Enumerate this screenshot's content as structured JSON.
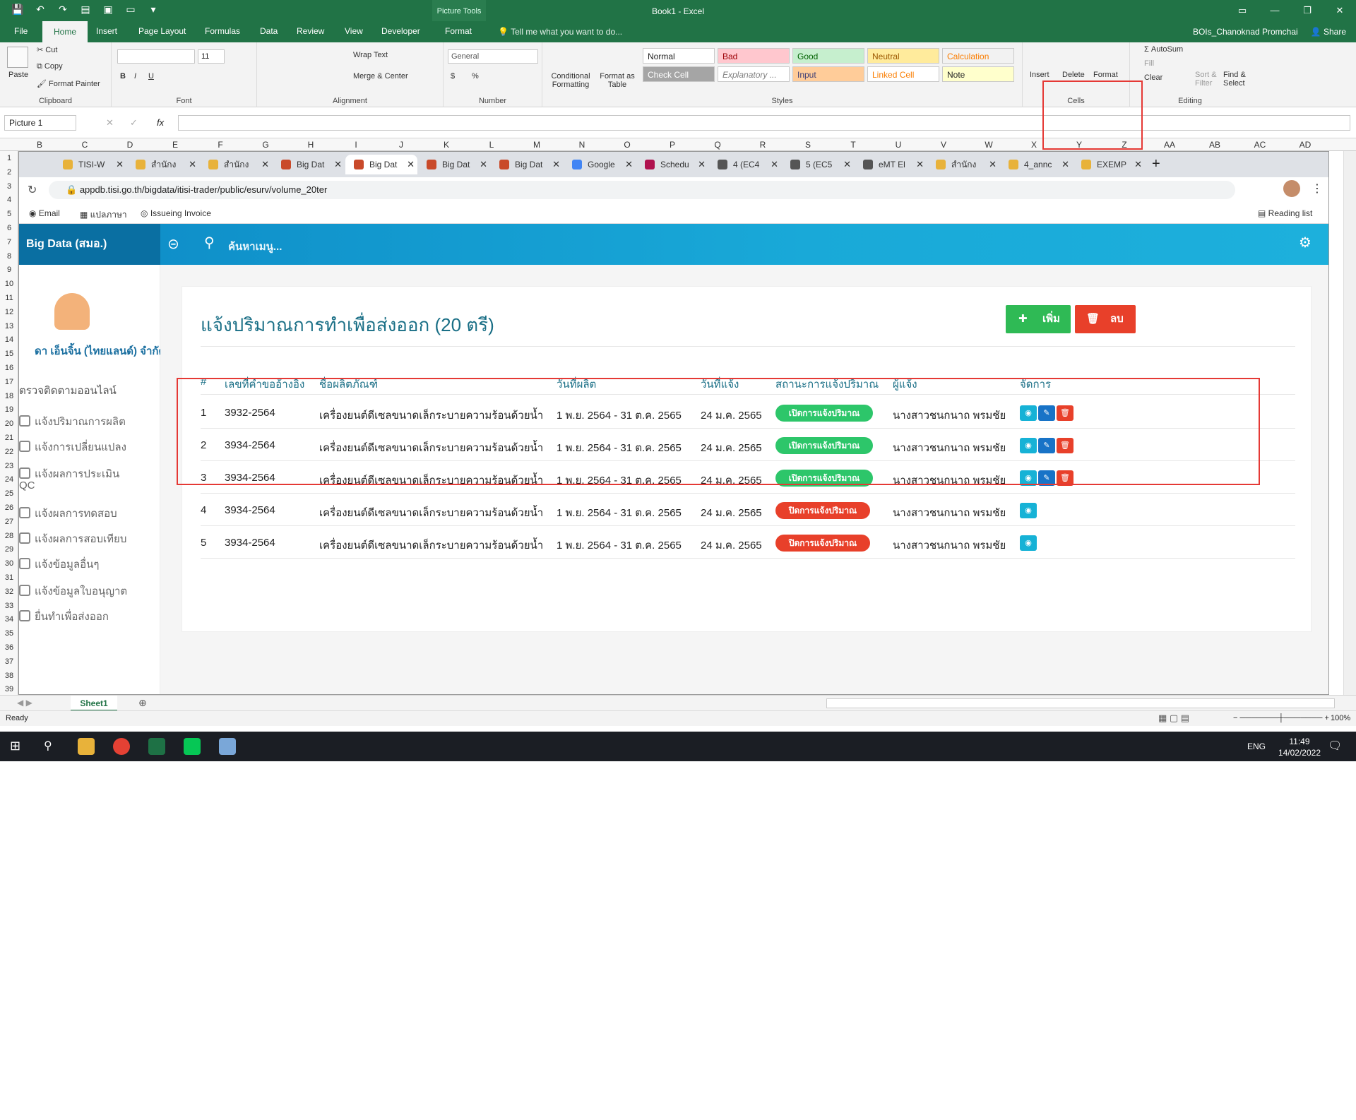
{
  "excel": {
    "title": "Book1 - Excel",
    "picture_tools": "Picture Tools",
    "tabs": [
      "File",
      "Home",
      "Insert",
      "Page Layout",
      "Formulas",
      "Data",
      "Review",
      "View",
      "Developer",
      "Format"
    ],
    "tell_me": "Tell me what you want to do...",
    "user": "BOIs_Chanoknad Promchai",
    "share": "Share",
    "clipboard": {
      "paste": "Paste",
      "cut": "Cut",
      "copy": "Copy",
      "format_painter": "Format Painter",
      "label": "Clipboard"
    },
    "font": {
      "size": "11",
      "label": "Font"
    },
    "alignment": {
      "wrap": "Wrap Text",
      "merge": "Merge & Center",
      "label": "Alignment"
    },
    "number": {
      "format": "General",
      "label": "Number"
    },
    "styles": {
      "conditional": "Conditional Formatting",
      "format_table": "Format as Table",
      "cells_row1": [
        "Normal",
        "Bad",
        "Good",
        "Neutral",
        "Calculation"
      ],
      "cells_row2": [
        "Check Cell",
        "Explanatory ...",
        "Input",
        "Linked Cell",
        "Note"
      ],
      "label": "Styles"
    },
    "cells": {
      "insert": "Insert",
      "delete": "Delete",
      "format": "Format",
      "label": "Cells"
    },
    "editing": {
      "autosum": "AutoSum",
      "fill": "Fill",
      "clear": "Clear",
      "sort": "Sort & Filter",
      "find": "Find & Select",
      "label": "Editing"
    },
    "name_box": "Picture 1",
    "fx": "fx",
    "columns": [
      "B",
      "C",
      "D",
      "E",
      "F",
      "G",
      "H",
      "I",
      "J",
      "K",
      "L",
      "M",
      "N",
      "O",
      "P",
      "Q",
      "R",
      "S",
      "T",
      "U",
      "V",
      "W",
      "X",
      "Y",
      "Z",
      "AA",
      "AB",
      "AC",
      "AD"
    ],
    "rows": [
      "1",
      "2",
      "3",
      "4",
      "5",
      "6",
      "7",
      "8",
      "9",
      "10",
      "11",
      "12",
      "13",
      "14",
      "15",
      "16",
      "17",
      "18",
      "19",
      "20",
      "21",
      "22",
      "23",
      "24",
      "25",
      "26",
      "27",
      "28",
      "29",
      "30",
      "31",
      "32",
      "33",
      "34",
      "35",
      "36",
      "37",
      "38",
      "39"
    ],
    "sheet": "Sheet1",
    "status": "Ready",
    "zoom": "100%"
  },
  "browser": {
    "tabs": [
      "TISI-W",
      "สำนักง",
      "สำนักง",
      "Big Dat",
      "Big Dat",
      "Big Dat",
      "Big Dat",
      "Google",
      "Schedu",
      "4 (EC4",
      "5 (EC5",
      "eMT El",
      "สำนักง",
      "4_annc",
      "EXEMP"
    ],
    "active_tab": 4,
    "url": "appdb.tisi.go.th/bigdata/itisi-trader/public/esurv/volume_20ter",
    "bookmarks": [
      "Email",
      "แปลภาษา",
      "Issueing Invoice"
    ],
    "reading_list": "Reading list"
  },
  "app": {
    "brand": "Big Data (สมอ.)",
    "search_placeholder": "ค้นหาเมนู...",
    "company": "ดา เอ็นจิ้น (ไทยแลนด์) จำกัด",
    "sidebar_section": "ตรวจติดตามออนไลน์",
    "sidebar": [
      "แจ้งปริมาณการผลิต",
      "แจ้งการเปลี่ยนแปลง",
      "แจ้งผลการประเมิน",
      "QC",
      "แจ้งผลการทดสอบ",
      "แจ้งผลการสอบเทียบ",
      "แจ้งข้อมูลอื่นๆ",
      "แจ้งข้อมูลใบอนุญาต",
      "ยื่นทำเพื่อส่งออก"
    ],
    "page_title": "แจ้งปริมาณการทำเพื่อส่งออก (20 ตรี)",
    "btn_add": "เพิ่ม",
    "btn_delete": "ลบ",
    "headers": [
      "#",
      "เลขที่คำขออ้างอิง",
      "ชื่อผลิตภัณฑ์",
      "วันที่ผลิต",
      "วันที่แจ้ง",
      "สถานะการแจ้งปริมาณ",
      "ผู้แจ้ง",
      "จัดการ"
    ],
    "rows": [
      {
        "no": "1",
        "ref": "3932-2564",
        "product": "เครื่องยนต์ดีเซลขนาดเล็กระบายความร้อนด้วยน้ำ",
        "produced": "1 พ.ย. 2564 - 31 ต.ค. 2565",
        "notified": "24 ม.ค. 2565",
        "status": "เปิดการแจ้งปริมาณ",
        "status_type": "open",
        "reporter": "นางสาวชนกนาถ พรมชัย",
        "actions": [
          "view",
          "edit",
          "delete"
        ]
      },
      {
        "no": "2",
        "ref": "3934-2564",
        "product": "เครื่องยนต์ดีเซลขนาดเล็กระบายความร้อนด้วยน้ำ",
        "produced": "1 พ.ย. 2564 - 31 ต.ค. 2565",
        "notified": "24 ม.ค. 2565",
        "status": "เปิดการแจ้งปริมาณ",
        "status_type": "open",
        "reporter": "นางสาวชนกนาถ พรมชัย",
        "actions": [
          "view",
          "edit",
          "delete"
        ]
      },
      {
        "no": "3",
        "ref": "3934-2564",
        "product": "เครื่องยนต์ดีเซลขนาดเล็กระบายความร้อนด้วยน้ำ",
        "produced": "1 พ.ย. 2564 - 31 ต.ค. 2565",
        "notified": "24 ม.ค. 2565",
        "status": "เปิดการแจ้งปริมาณ",
        "status_type": "open",
        "reporter": "นางสาวชนกนาถ พรมชัย",
        "actions": [
          "view",
          "edit",
          "delete"
        ]
      },
      {
        "no": "4",
        "ref": "3934-2564",
        "product": "เครื่องยนต์ดีเซลขนาดเล็กระบายความร้อนด้วยน้ำ",
        "produced": "1 พ.ย. 2564 - 31 ต.ค. 2565",
        "notified": "24 ม.ค. 2565",
        "status": "ปิดการแจ้งปริมาณ",
        "status_type": "closed",
        "reporter": "นางสาวชนกนาถ พรมชัย",
        "actions": [
          "view"
        ]
      },
      {
        "no": "5",
        "ref": "3934-2564",
        "product": "เครื่องยนต์ดีเซลขนาดเล็กระบายความร้อนด้วยน้ำ",
        "produced": "1 พ.ย. 2564 - 31 ต.ค. 2565",
        "notified": "24 ม.ค. 2565",
        "status": "ปิดการแจ้งปริมาณ",
        "status_type": "closed",
        "reporter": "นางสาวชนกนาถ พรมชัย",
        "actions": [
          "view"
        ]
      }
    ]
  },
  "taskbar": {
    "lang": "ENG",
    "time": "11:49",
    "date": "14/02/2022"
  },
  "colors": {
    "excel_green": "#217346",
    "header_blue": "#19a9d8",
    "open_green": "#2dc66a",
    "closed_red": "#e8402a",
    "highlight": "#e53935"
  }
}
